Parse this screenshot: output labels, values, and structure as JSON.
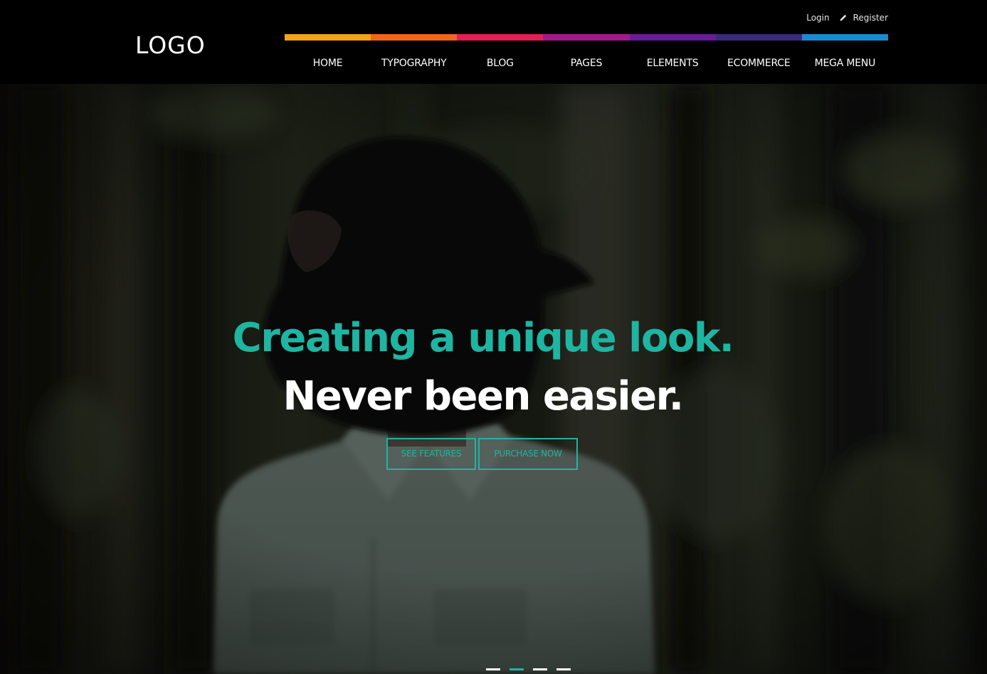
{
  "header": {
    "logo": "LOGO",
    "account": {
      "login": "Login",
      "register": "Register",
      "register_icon": "pencil-icon"
    },
    "color_strip": [
      "#f7a21b",
      "#f0661c",
      "#e41f55",
      "#a21a8c",
      "#6a1b9a",
      "#3a2a7a",
      "#1a8ad4"
    ],
    "nav": [
      {
        "label": "HOME"
      },
      {
        "label": "TYPOGRAPHY"
      },
      {
        "label": "BLOG"
      },
      {
        "label": "PAGES"
      },
      {
        "label": "ELEMENTS"
      },
      {
        "label": "ECOMMERCE"
      },
      {
        "label": "MEGA MENU"
      }
    ]
  },
  "hero": {
    "headline_accent": "Creating a unique look.",
    "headline_main": "Never been easier.",
    "buttons": {
      "features": "SEE FEATURES",
      "purchase": "PURCHASE NOW"
    },
    "slider": {
      "slide_count": 4,
      "active_index": 1
    }
  },
  "colors": {
    "accent": "#1eb5a2",
    "header_bg": "#000000",
    "text_light": "#ffffff",
    "dot_active": "#1eb5a2",
    "dot_inactive": "#ffffff"
  }
}
